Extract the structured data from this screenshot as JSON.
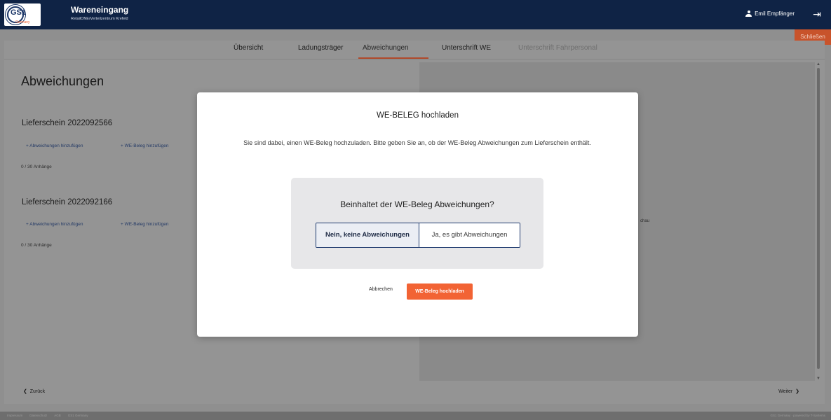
{
  "header": {
    "logo_text": "GS1",
    "logo_sub": "Germany",
    "title": "Wareneingang",
    "subtitle": "RetailONE/Verteilzentrum Krefeld",
    "user_name": "Emil Empfänger",
    "user_icon": "user-icon",
    "logout_icon": "logout-icon"
  },
  "close_button": "Schließen",
  "tabs": [
    {
      "label": "Übersicht"
    },
    {
      "label": "Ladungsträger"
    },
    {
      "label": "Abweichungen"
    },
    {
      "label": "Unterschrift WE"
    },
    {
      "label": "Unterschrift Fahrpersonal"
    }
  ],
  "page": {
    "title": "Abweichungen",
    "lieferscheine": [
      {
        "title": "Lieferschein 2022092566",
        "add_deviation": "+ Abweichungen hinzufügen",
        "add_receipt": "+ WE-Beleg hinzufügen",
        "attachments": "0 / 30 Anhänge"
      },
      {
        "title": "Lieferschein 2022092166",
        "add_deviation": "+ Abweichungen hinzufügen",
        "add_receipt": "+ WE-Beleg hinzufügen",
        "attachments": "0 / 30 Anhänge"
      }
    ],
    "preview_fragment": "chau",
    "back": "Zurück",
    "next": "Weiter"
  },
  "footer": {
    "links": [
      "Impressum",
      "Datenschutz",
      "AGB",
      "GS1 Germany"
    ],
    "right": "GS1 Germany · powered by T-Systems"
  },
  "modal": {
    "title": "WE-BELEG hochladen",
    "text": "Sie sind dabei, einen WE-Beleg hochzuladen. Bitte geben Sie an, ob der WE-Beleg Abweichungen zum Lieferschein enthält.",
    "question": "Beinhaltet der WE-Beleg Abweichungen?",
    "option_no": "Nein, keine Abweichungen",
    "option_yes": "Ja, es gibt Abweichungen",
    "selected": "Nein, keine Abweichungen",
    "cancel": "Abbrechen",
    "upload": "WE-Beleg hochladen"
  },
  "colors": {
    "header_bg": "#0f2345",
    "accent": "#f26334",
    "primary_border": "#1e3a6e"
  }
}
